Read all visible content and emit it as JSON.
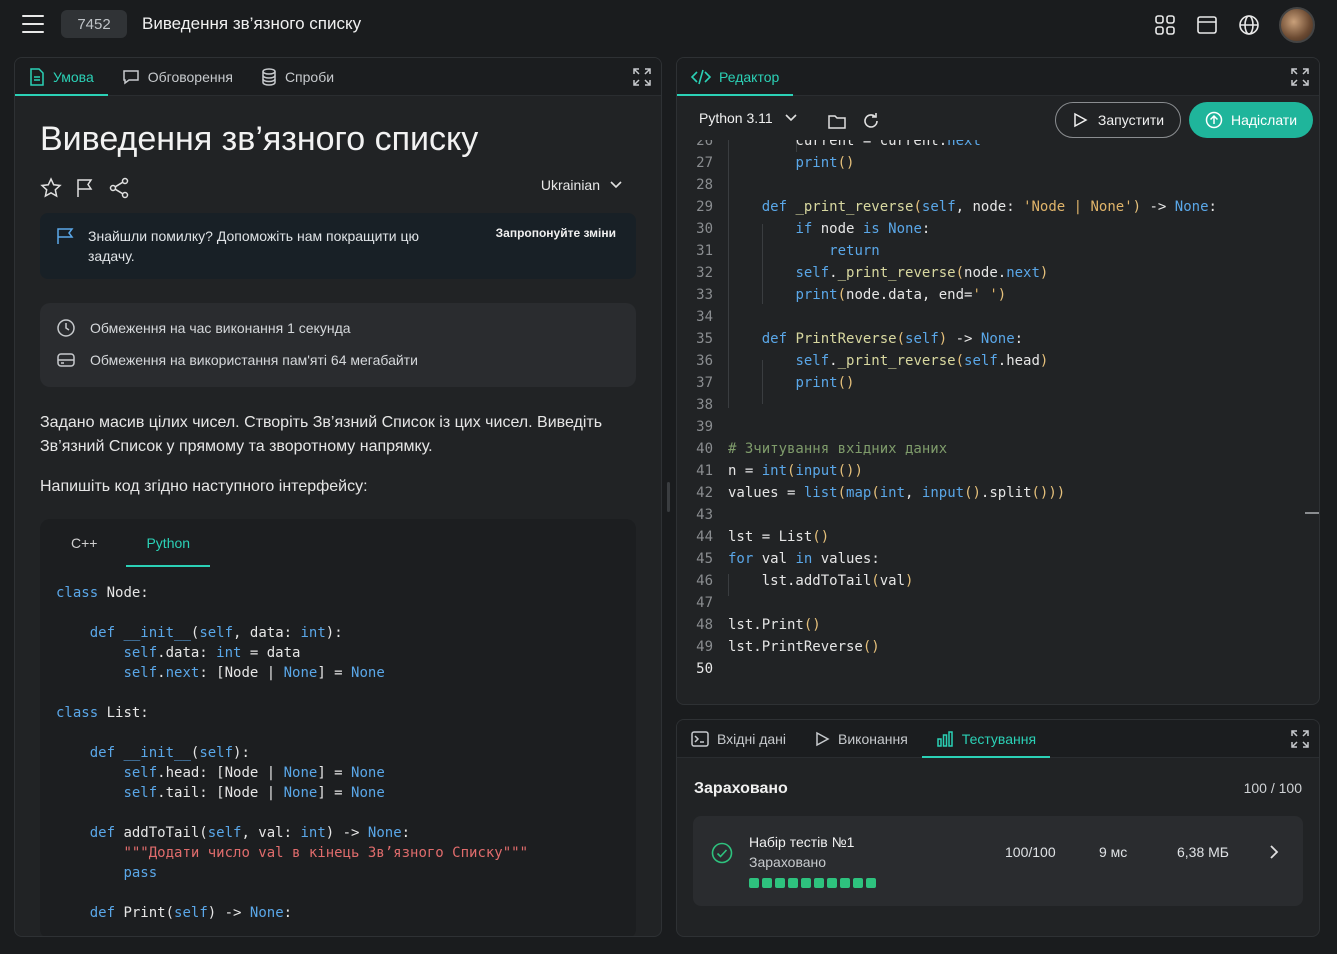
{
  "topbar": {
    "problem_id": "7452",
    "problem_title": "Виведення зв’язного списку",
    "icons": [
      "apps-grid-icon",
      "window-icon",
      "globe-icon"
    ]
  },
  "left_tabs": [
    {
      "label": "Умова",
      "icon": "document-icon",
      "active": true
    },
    {
      "label": "Обговорення",
      "icon": "chat-icon",
      "active": false
    },
    {
      "label": "Спроби",
      "icon": "database-icon",
      "active": false
    }
  ],
  "statement": {
    "title": "Виведення зв’язного списку",
    "language": "Ukrainian",
    "suggest_text": "Знайшли помилку? Допоможіть нам покращити цю задачу.",
    "suggest_link": "Запропонуйте зміни",
    "time_limit": "Обмеження на час виконання 1 секунда",
    "memory_limit": "Обмеження на використання пам'яті 64 мегабайти",
    "paragraph1": "Задано масив цілих чисел. Створіть Зв’язний Список із цих чисел. Виведіть Зв’язний Список у прямому та зворотному напрямку.",
    "paragraph2": "Напишіть код згідно наступного інтерфейсу:",
    "code_tabs": [
      "C++",
      "Python"
    ],
    "code_tab_active": "Python"
  },
  "editor": {
    "tab_label": "Редактор",
    "language": "Python 3.11",
    "run_label": "Запустити",
    "submit_label": "Надіслати",
    "current_line": 50
  },
  "bottom_tabs": [
    {
      "label": "Вхідні дані",
      "icon": "terminal-icon",
      "active": false
    },
    {
      "label": "Виконання",
      "icon": "play-icon",
      "active": false
    },
    {
      "label": "Тестування",
      "icon": "bar-chart-icon",
      "active": true
    }
  ],
  "results": {
    "verdict": "Зараховано",
    "score": "100 / 100",
    "test_set": {
      "name": "Набір тестів №1",
      "status": "Зараховано",
      "score": "100/100",
      "time": "9 мс",
      "memory": "6,38 МБ",
      "passed_tests": 10
    }
  },
  "colors": {
    "accent": "#2bd1b6",
    "submit": "#1fb59b",
    "pass": "#2ec27e",
    "background": "#1a1c1e"
  }
}
